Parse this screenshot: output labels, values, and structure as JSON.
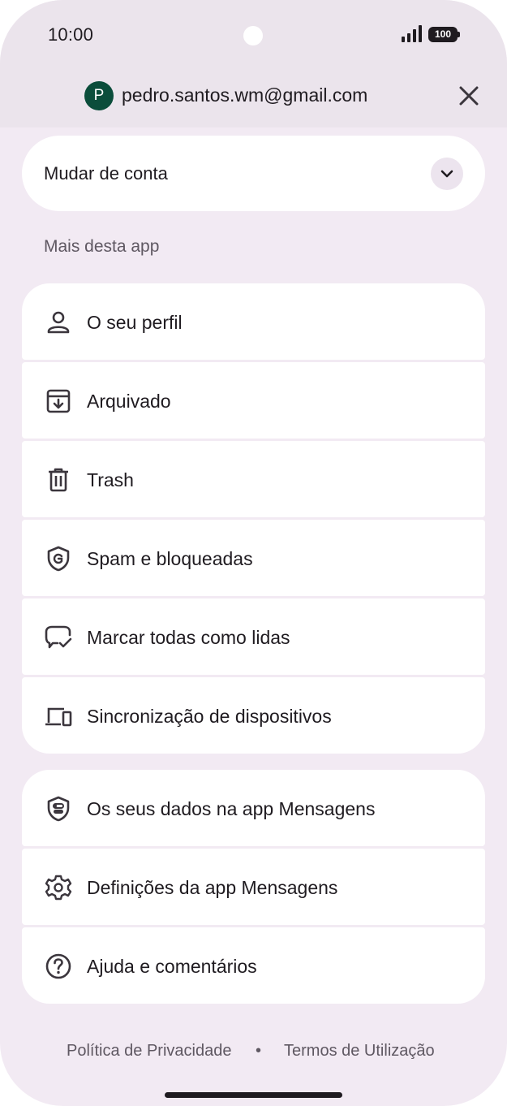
{
  "status_bar": {
    "time": "10:00",
    "battery_level": "100",
    "signal_icon": "signal-bars-icon",
    "battery_icon": "battery-icon"
  },
  "header": {
    "avatar_initial": "P",
    "avatar_color": "#0b4d3b",
    "email": "pedro.santos.wm@gmail.com",
    "close_icon": "close-icon"
  },
  "switch_account": {
    "label": "Mudar de conta",
    "chevron_icon": "chevron-down-icon"
  },
  "section_label": "Mais desta app",
  "menu_group_1": [
    {
      "label": "O seu perfil",
      "icon": "person-icon"
    },
    {
      "label": "Arquivado",
      "icon": "archive-icon"
    },
    {
      "label": "Trash",
      "icon": "trash-icon"
    },
    {
      "label": "Spam e bloqueadas",
      "icon": "shield-icon"
    },
    {
      "label": "Marcar todas como lidas",
      "icon": "mark-read-icon"
    },
    {
      "label": "Sincronização de dispositivos",
      "icon": "devices-icon"
    }
  ],
  "menu_group_2": [
    {
      "label": "Os seus dados na app Mensagens",
      "icon": "privacy-shield-icon"
    },
    {
      "label": "Definições da app Mensagens",
      "icon": "gear-icon"
    },
    {
      "label": "Ajuda e comentários",
      "icon": "help-icon"
    }
  ],
  "footer": {
    "privacy": "Política de Privacidade",
    "separator": "•",
    "terms": "Termos de Utilização"
  },
  "colors": {
    "background": "#f2eaf3",
    "card": "#ffffff",
    "text": "#1f1b20",
    "secondary_text": "#5f5862"
  }
}
